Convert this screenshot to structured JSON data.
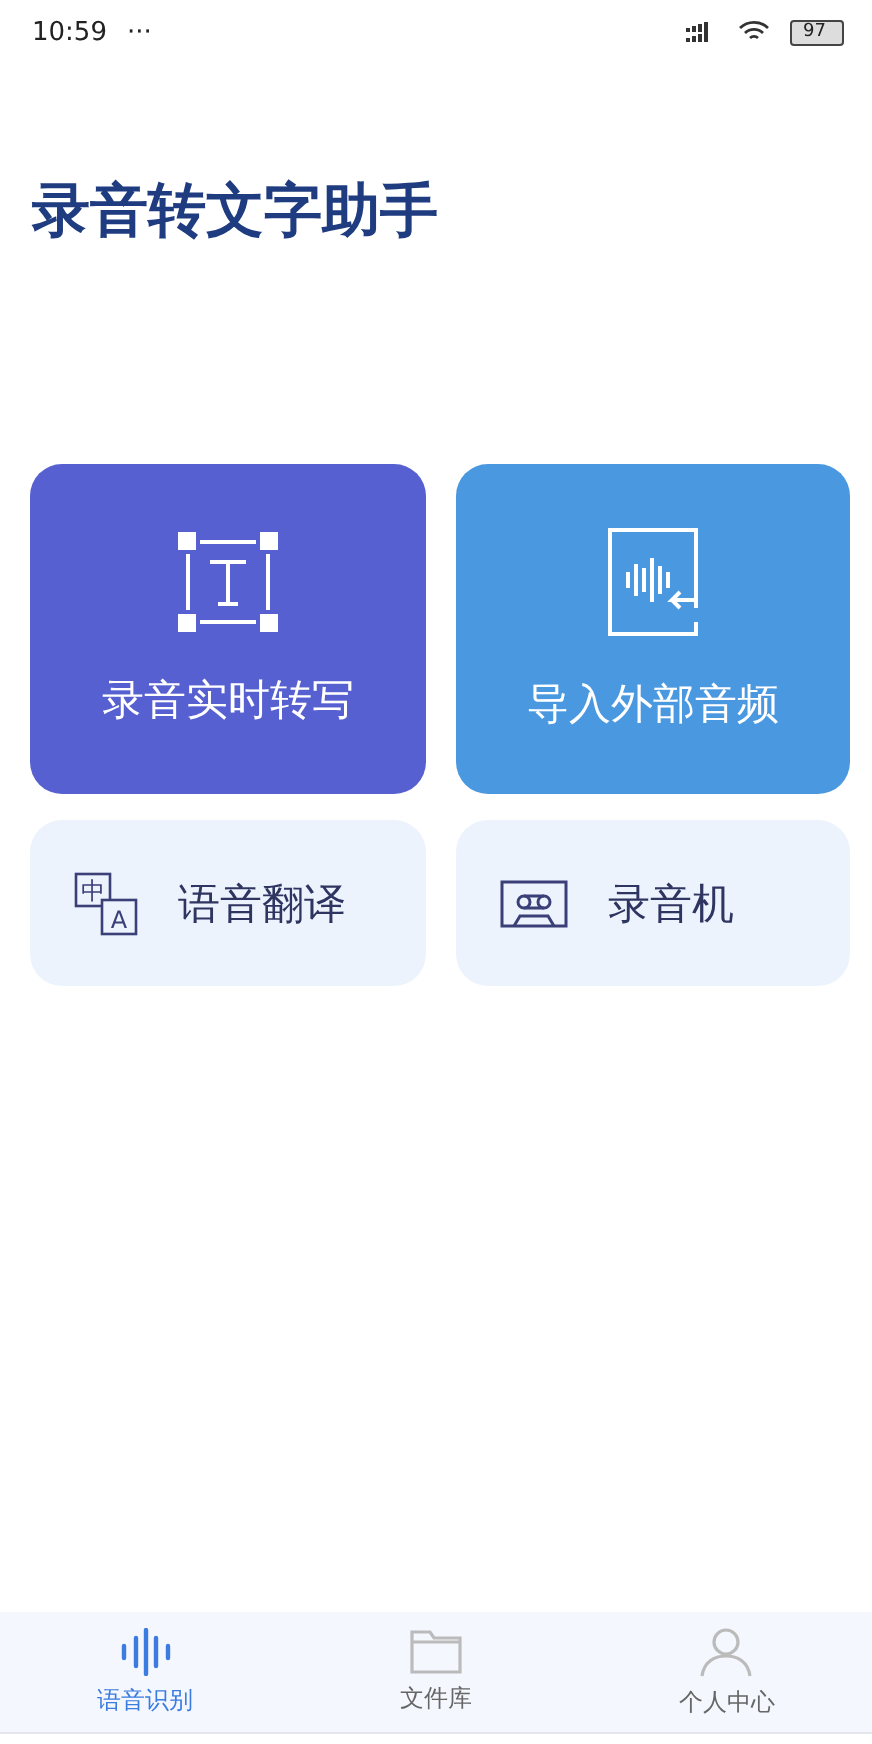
{
  "status_bar": {
    "time": "10:59",
    "dots": "···",
    "battery": "97"
  },
  "title": "录音转文字助手",
  "feature_cards": [
    {
      "label": "录音实时转写",
      "kind": "transcribe",
      "color": "#5760d0"
    },
    {
      "label": "导入外部音频",
      "kind": "import",
      "color": "#4a98e0"
    }
  ],
  "tool_cards": [
    {
      "label": "语音翻译",
      "kind": "translate",
      "glyphs": [
        "中",
        "A"
      ]
    },
    {
      "label": "录音机",
      "kind": "recorder"
    }
  ],
  "tab_bar": [
    {
      "label": "语音识别",
      "kind": "wave",
      "selected": true
    },
    {
      "label": "文件库",
      "kind": "folder",
      "selected": false
    },
    {
      "label": "个人中心",
      "kind": "person",
      "selected": false
    }
  ]
}
